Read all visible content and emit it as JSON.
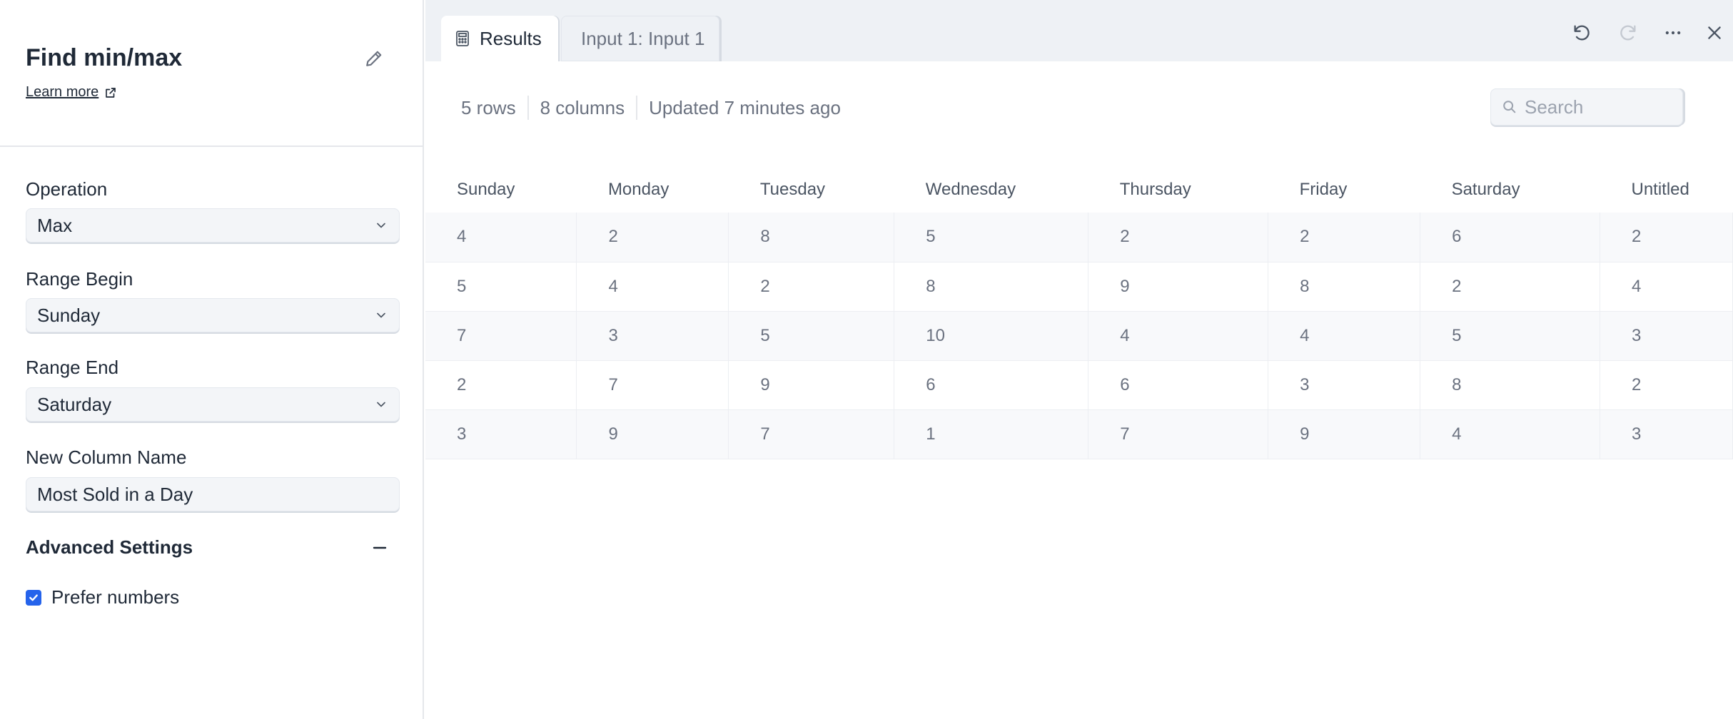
{
  "panel": {
    "title": "Find min/max",
    "learn_more": "Learn more",
    "fields": {
      "operation": {
        "label": "Operation",
        "value": "Max"
      },
      "range_begin": {
        "label": "Range Begin",
        "value": "Sunday"
      },
      "range_end": {
        "label": "Range End",
        "value": "Saturday"
      },
      "new_column_name": {
        "label": "New Column Name",
        "value": "Most Sold in a Day"
      }
    },
    "advanced": {
      "title": "Advanced Settings",
      "prefer_numbers": {
        "label": "Prefer numbers",
        "checked": true
      }
    }
  },
  "tabs": [
    {
      "label": "Results",
      "active": true,
      "icon": "calculator-icon"
    },
    {
      "label": "Input 1: Input 1",
      "active": false
    }
  ],
  "toolbar": {
    "icons": [
      "undo-icon",
      "redo-icon",
      "more-icon",
      "close-icon"
    ]
  },
  "meta": {
    "rows": "5 rows",
    "columns": "8 columns",
    "updated": "Updated 7 minutes ago"
  },
  "search": {
    "placeholder": "Search"
  },
  "table": {
    "columns": [
      "Sunday",
      "Monday",
      "Tuesday",
      "Wednesday",
      "Thursday",
      "Friday",
      "Saturday",
      "Untitled"
    ],
    "rows": [
      [
        "4",
        "2",
        "8",
        "5",
        "2",
        "2",
        "6",
        "2"
      ],
      [
        "5",
        "4",
        "2",
        "8",
        "9",
        "8",
        "2",
        "4"
      ],
      [
        "7",
        "3",
        "5",
        "10",
        "4",
        "4",
        "5",
        "3"
      ],
      [
        "2",
        "7",
        "9",
        "6",
        "6",
        "3",
        "8",
        "2"
      ],
      [
        "3",
        "9",
        "7",
        "1",
        "7",
        "9",
        "4",
        "3"
      ]
    ]
  },
  "colors": {
    "accent": "#2563eb",
    "tabbar": "#eef1f5"
  }
}
